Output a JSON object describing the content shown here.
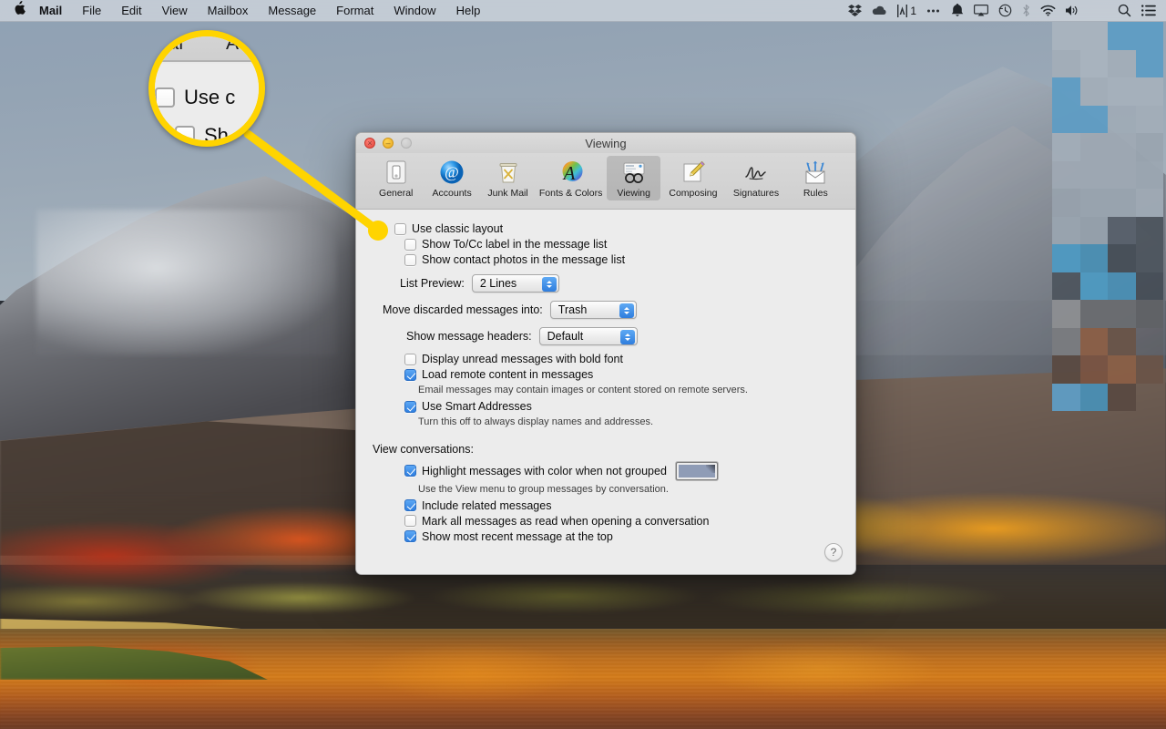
{
  "menubar": {
    "apple_icon": "apple-logo-icon",
    "items": [
      "Mail",
      "File",
      "Edit",
      "View",
      "Mailbox",
      "Message",
      "Format",
      "Window",
      "Help"
    ],
    "status_items": [
      {
        "name": "dropbox-icon",
        "label": ""
      },
      {
        "name": "cloud-icon",
        "label": ""
      },
      {
        "name": "adobe-creative-cloud-icon",
        "label": "1"
      },
      {
        "name": "ellipsis-icon",
        "label": ""
      },
      {
        "name": "notification-bell-icon",
        "label": ""
      },
      {
        "name": "airplay-icon",
        "label": ""
      },
      {
        "name": "time-machine-icon",
        "label": ""
      },
      {
        "name": "bluetooth-icon",
        "label": ""
      },
      {
        "name": "wifi-icon",
        "label": ""
      },
      {
        "name": "volume-icon",
        "label": ""
      },
      {
        "name": "spotlight-search-icon",
        "label": ""
      },
      {
        "name": "notification-center-icon",
        "label": ""
      }
    ]
  },
  "window": {
    "title": "Viewing",
    "traffic_lights": [
      "close",
      "minimize",
      "zoom-disabled"
    ],
    "toolbar": [
      {
        "label": "General",
        "icon": "general-icon",
        "selected": false
      },
      {
        "label": "Accounts",
        "icon": "accounts-at-icon",
        "selected": false
      },
      {
        "label": "Junk Mail",
        "icon": "junk-mail-icon",
        "selected": false
      },
      {
        "label": "Fonts & Colors",
        "icon": "fonts-colors-icon",
        "selected": false
      },
      {
        "label": "Viewing",
        "icon": "viewing-glasses-icon",
        "selected": true
      },
      {
        "label": "Composing",
        "icon": "composing-pencil-icon",
        "selected": false
      },
      {
        "label": "Signatures",
        "icon": "signatures-icon",
        "selected": false
      },
      {
        "label": "Rules",
        "icon": "rules-icon",
        "selected": false
      }
    ]
  },
  "panel": {
    "use_classic_layout": {
      "label": "Use classic layout",
      "checked": false
    },
    "show_to_cc": {
      "label": "Show To/Cc label in the message list",
      "checked": false
    },
    "show_contact_photos": {
      "label": "Show contact photos in the message list",
      "checked": false
    },
    "list_preview": {
      "label": "List Preview:",
      "value": "2 Lines"
    },
    "move_discarded": {
      "label": "Move discarded messages into:",
      "value": "Trash"
    },
    "show_headers": {
      "label": "Show message headers:",
      "value": "Default"
    },
    "display_unread_bold": {
      "label": "Display unread messages with bold font",
      "checked": false
    },
    "load_remote_content": {
      "label": "Load remote content in messages",
      "checked": true
    },
    "load_remote_content_note": "Email messages may contain images or content stored on remote servers.",
    "use_smart_addresses": {
      "label": "Use Smart Addresses",
      "checked": true
    },
    "use_smart_addresses_note": "Turn this off to always display names and addresses.",
    "view_conversations_title": "View conversations:",
    "highlight_messages": {
      "label": "Highlight messages with color when not grouped",
      "checked": true
    },
    "highlight_messages_note": "Use the View menu to group messages by conversation.",
    "highlight_color": "#8f9cb6",
    "include_related": {
      "label": "Include related messages",
      "checked": true
    },
    "mark_all_read": {
      "label": "Mark all messages as read when opening a conversation",
      "checked": false
    },
    "show_most_recent": {
      "label": "Show most recent message at the top",
      "checked": true
    },
    "help_label": "?"
  },
  "callout": {
    "accent_color": "#FFD400",
    "magnified_toolbar_left": "eral",
    "magnified_toolbar_right": "A",
    "magnified_row1": "Use c",
    "magnified_row2": "Sh"
  },
  "mosaic_colors": [
    "#a9b4bf",
    "#a9b4bf",
    "#5f9dc4",
    "#5f9dc4",
    "#a3aeb9",
    "#a9b4bf",
    "#a3aeb9",
    "#5f9dc4",
    "#5f9dc4",
    "#a3aeb9",
    "#a6b1bc",
    "#a6b1bc",
    "#5f9dc4",
    "#5f9dc4",
    "#a0abb6",
    "#a3aeb9",
    "#a3aeb9",
    "#9fa9b4",
    "#9fa9b4",
    "#9aa5b0",
    "#9fa9b4",
    "#9fa9b4",
    "#9fa9b4",
    "#9ca7b2",
    "#97a2ad",
    "#9aa5b0",
    "#9aa5b0",
    "#a0abb6",
    "#9aa5b0",
    "#96a1ac",
    "#58606b",
    "#4e565f",
    "#4e9ac2",
    "#4a8fb4",
    "#464e57",
    "#4e565f",
    "#4e565f",
    "#4e9ac2",
    "#4a8fb4",
    "#464e57",
    "#8d8f92",
    "#6a6c70",
    "#6a6c70",
    "#606266",
    "#7a7c80",
    "#8b5f46",
    "#6a5448",
    "#58494330",
    "#5a4a42",
    "#7a5442",
    "#8b5f46",
    "#6a5448",
    "#5f9dc4",
    "#4a8fb4",
    "#5a4a42"
  ]
}
